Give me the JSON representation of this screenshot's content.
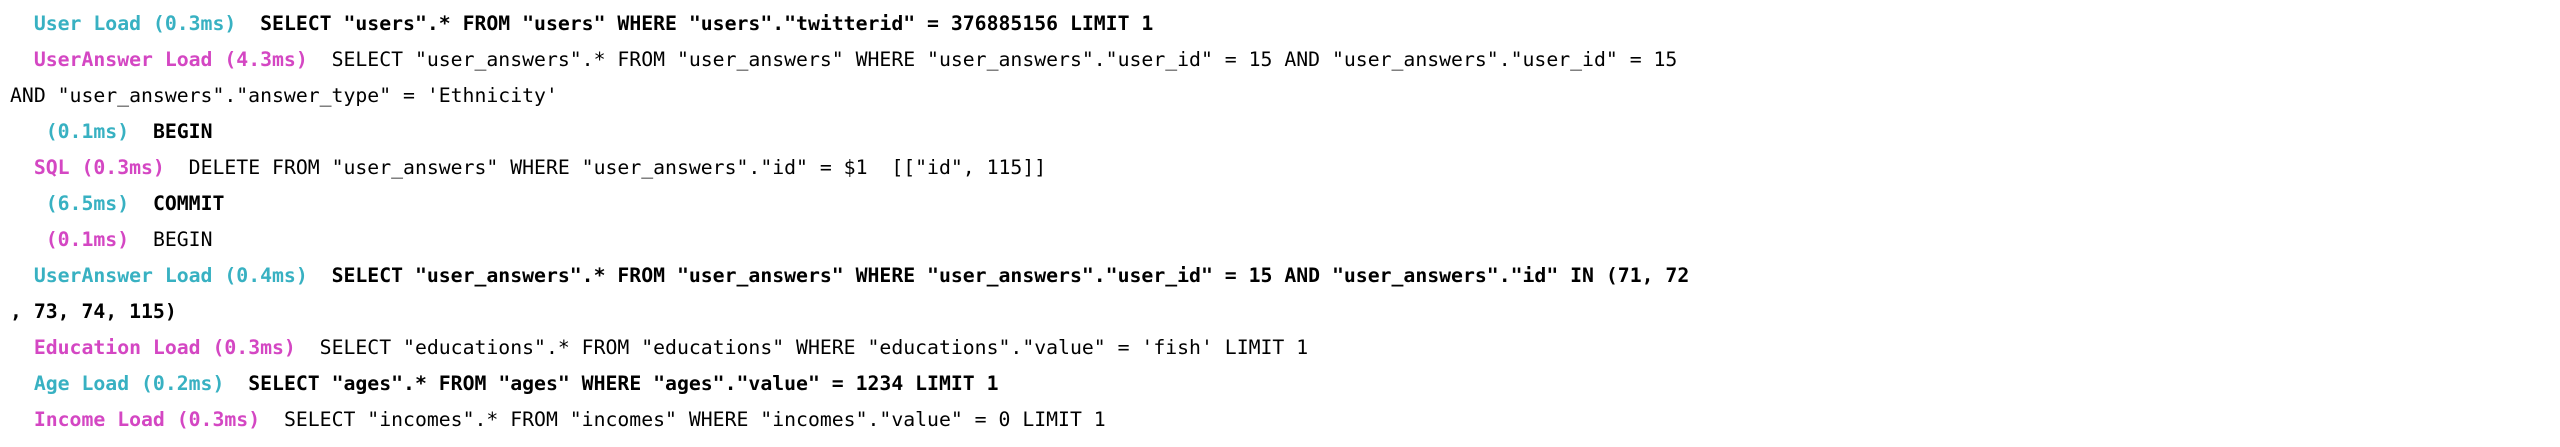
{
  "colors": {
    "cyan": "#38b1c2",
    "magenta": "#d447c3",
    "text": "#000000",
    "background": "#ffffff"
  },
  "lines": [
    {
      "pre": "  ",
      "label": "User Load (0.3ms)",
      "label_color": "cyan",
      "gap": "  ",
      "sql": "SELECT \"users\".* FROM \"users\" WHERE \"users\".\"twitterid\" = 376885156 LIMIT 1",
      "sql_bold": true
    },
    {
      "pre": "  ",
      "label": "UserAnswer Load (4.3ms)",
      "label_color": "magenta",
      "gap": "  ",
      "sql": "SELECT \"user_answers\".* FROM \"user_answers\" WHERE \"user_answers\".\"user_id\" = 15 AND \"user_answers\".\"user_id\" = 15",
      "sql_bold": false
    },
    {
      "pre": "",
      "label": "",
      "label_color": "cyan",
      "gap": "",
      "sql": "AND \"user_answers\".\"answer_type\" = 'Ethnicity'",
      "sql_bold": false
    },
    {
      "pre": "   ",
      "label": "(0.1ms)",
      "label_color": "cyan",
      "gap": "  ",
      "sql": "BEGIN",
      "sql_bold": true
    },
    {
      "pre": "  ",
      "label": "SQL (0.3ms)",
      "label_color": "magenta",
      "gap": "  ",
      "sql": "DELETE FROM \"user_answers\" WHERE \"user_answers\".\"id\" = $1  [[\"id\", 115]]",
      "sql_bold": false
    },
    {
      "pre": "   ",
      "label": "(6.5ms)",
      "label_color": "cyan",
      "gap": "  ",
      "sql": "COMMIT",
      "sql_bold": true
    },
    {
      "pre": "   ",
      "label": "(0.1ms)",
      "label_color": "magenta",
      "gap": "  ",
      "sql": "BEGIN",
      "sql_bold": false
    },
    {
      "pre": "  ",
      "label": "UserAnswer Load (0.4ms)",
      "label_color": "cyan",
      "gap": "  ",
      "sql": "SELECT \"user_answers\".* FROM \"user_answers\" WHERE \"user_answers\".\"user_id\" = 15 AND \"user_answers\".\"id\" IN (71, 72",
      "sql_bold": true
    },
    {
      "pre": "",
      "label": "",
      "label_color": "cyan",
      "gap": "",
      "sql": ", 73, 74, 115)",
      "sql_bold": true
    },
    {
      "pre": "  ",
      "label": "Education Load (0.3ms)",
      "label_color": "magenta",
      "gap": "  ",
      "sql": "SELECT \"educations\".* FROM \"educations\" WHERE \"educations\".\"value\" = 'fish' LIMIT 1",
      "sql_bold": false
    },
    {
      "pre": "  ",
      "label": "Age Load (0.2ms)",
      "label_color": "cyan",
      "gap": "  ",
      "sql": "SELECT \"ages\".* FROM \"ages\" WHERE \"ages\".\"value\" = 1234 LIMIT 1",
      "sql_bold": true
    },
    {
      "pre": "  ",
      "label": "Income Load (0.3ms)",
      "label_color": "magenta",
      "gap": "  ",
      "sql": "SELECT \"incomes\".* FROM \"incomes\" WHERE \"incomes\".\"value\" = 0 LIMIT 1",
      "sql_bold": false
    }
  ]
}
